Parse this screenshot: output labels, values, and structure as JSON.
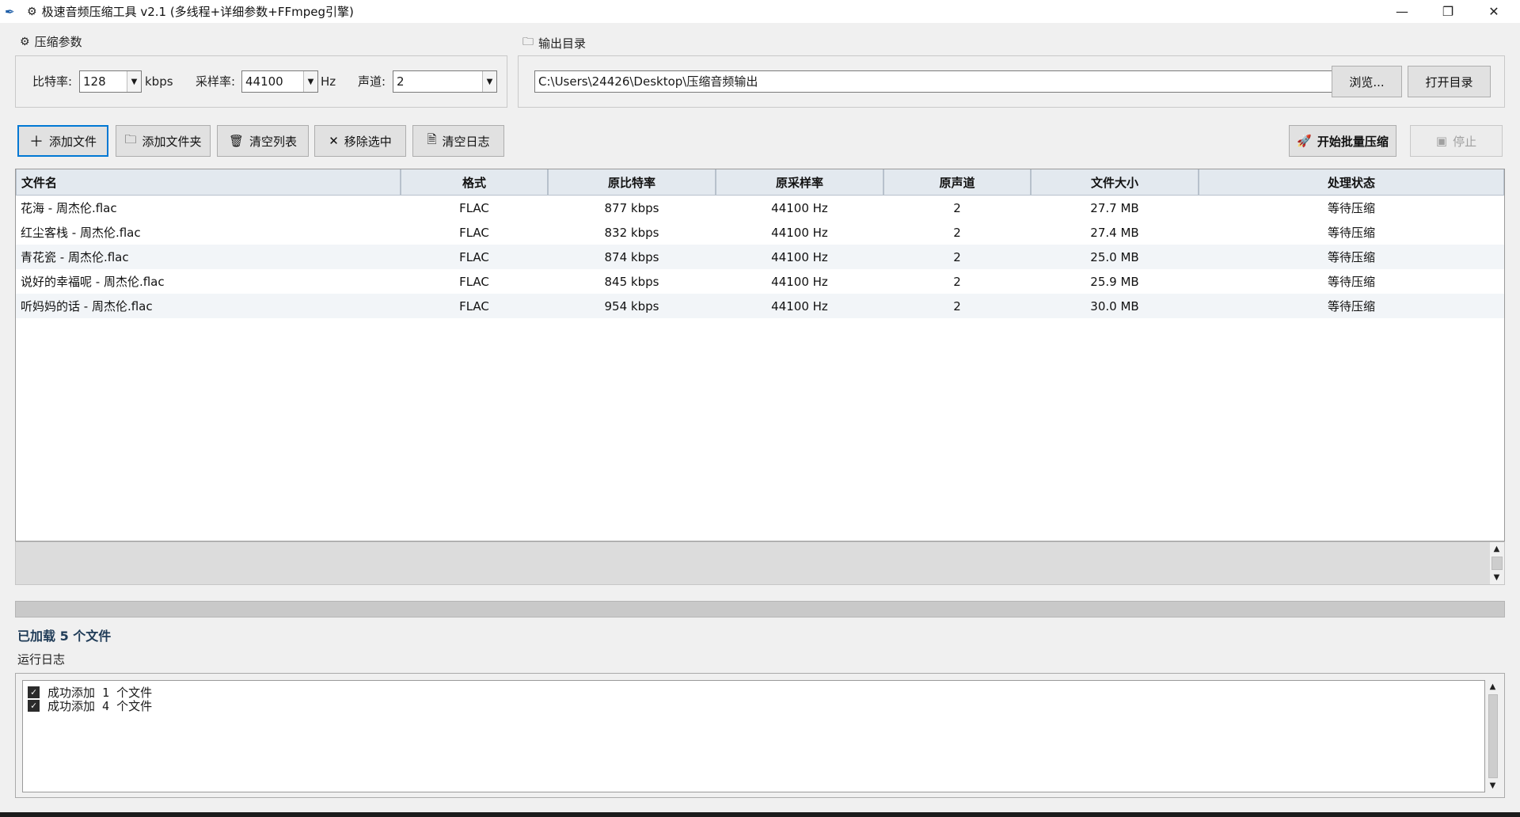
{
  "window": {
    "title": "极速音频压缩工具 v2.1 (多线程+详细参数+FFmpeg引擎)",
    "minimize_glyph": "—",
    "maximize_glyph": "❐",
    "close_glyph": "✕"
  },
  "params": {
    "group_title": "压缩参数",
    "bitrate_label": "比特率:",
    "bitrate_value": "128",
    "bitrate_unit": "kbps",
    "samplerate_label": "采样率:",
    "samplerate_value": "44100",
    "samplerate_unit": "Hz",
    "channels_label": "声道:",
    "channels_value": "2"
  },
  "output": {
    "group_title": "输出目录",
    "path": "C:\\Users\\24426\\Desktop\\压缩音频输出",
    "browse_label": "浏览...",
    "open_label": "打开目录"
  },
  "toolbar": {
    "add_file": "添加文件",
    "add_folder": "添加文件夹",
    "clear_list": "清空列表",
    "remove_selected": "移除选中",
    "clear_log": "清空日志",
    "start_batch": "开始批量压缩",
    "stop": "停止"
  },
  "table": {
    "columns": [
      "文件名",
      "格式",
      "原比特率",
      "原采样率",
      "原声道",
      "文件大小",
      "处理状态"
    ],
    "rows": [
      [
        "花海 - 周杰伦.flac",
        "FLAC",
        "877 kbps",
        "44100 Hz",
        "2",
        "27.7 MB",
        "等待压缩"
      ],
      [
        "红尘客栈 - 周杰伦.flac",
        "FLAC",
        "832 kbps",
        "44100 Hz",
        "2",
        "27.4 MB",
        "等待压缩"
      ],
      [
        "青花瓷 - 周杰伦.flac",
        "FLAC",
        "874 kbps",
        "44100 Hz",
        "2",
        "25.0 MB",
        "等待压缩"
      ],
      [
        "说好的幸福呢 - 周杰伦.flac",
        "FLAC",
        "845 kbps",
        "44100 Hz",
        "2",
        "25.9 MB",
        "等待压缩"
      ],
      [
        "听妈妈的话 - 周杰伦.flac",
        "FLAC",
        "954 kbps",
        "44100 Hz",
        "2",
        "30.0 MB",
        "等待压缩"
      ]
    ]
  },
  "progress": {
    "fraction": 0
  },
  "status": {
    "text": "已加载 5 个文件"
  },
  "log": {
    "label": "运行日志",
    "lines": [
      "成功添加 1 个文件",
      "成功添加 4 个文件"
    ]
  },
  "colors": {
    "header_bg": "#e3e9ef",
    "alt_row_bg": "#f2f5f8",
    "status_text": "#1f3b57",
    "focus_border": "#0078d4"
  }
}
